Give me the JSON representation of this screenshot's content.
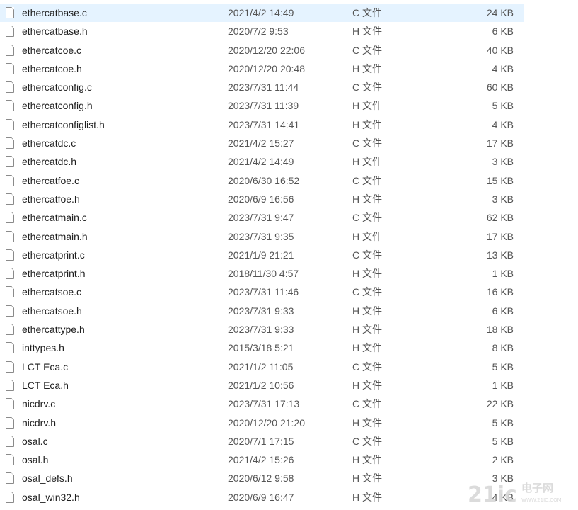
{
  "files": [
    {
      "name": "ethercatbase.c",
      "date": "2021/4/2 14:49",
      "type": "C 文件",
      "size": "24 KB",
      "selected": true
    },
    {
      "name": "ethercatbase.h",
      "date": "2020/7/2 9:53",
      "type": "H 文件",
      "size": "6 KB"
    },
    {
      "name": "ethercatcoe.c",
      "date": "2020/12/20 22:06",
      "type": "C 文件",
      "size": "40 KB"
    },
    {
      "name": "ethercatcoe.h",
      "date": "2020/12/20 20:48",
      "type": "H 文件",
      "size": "4 KB"
    },
    {
      "name": "ethercatconfig.c",
      "date": "2023/7/31 11:44",
      "type": "C 文件",
      "size": "60 KB"
    },
    {
      "name": "ethercatconfig.h",
      "date": "2023/7/31 11:39",
      "type": "H 文件",
      "size": "5 KB"
    },
    {
      "name": "ethercatconfiglist.h",
      "date": "2023/7/31 14:41",
      "type": "H 文件",
      "size": "4 KB"
    },
    {
      "name": "ethercatdc.c",
      "date": "2021/4/2 15:27",
      "type": "C 文件",
      "size": "17 KB"
    },
    {
      "name": "ethercatdc.h",
      "date": "2021/4/2 14:49",
      "type": "H 文件",
      "size": "3 KB"
    },
    {
      "name": "ethercatfoe.c",
      "date": "2020/6/30 16:52",
      "type": "C 文件",
      "size": "15 KB"
    },
    {
      "name": "ethercatfoe.h",
      "date": "2020/6/9 16:56",
      "type": "H 文件",
      "size": "3 KB"
    },
    {
      "name": "ethercatmain.c",
      "date": "2023/7/31 9:47",
      "type": "C 文件",
      "size": "62 KB"
    },
    {
      "name": "ethercatmain.h",
      "date": "2023/7/31 9:35",
      "type": "H 文件",
      "size": "17 KB"
    },
    {
      "name": "ethercatprint.c",
      "date": "2021/1/9 21:21",
      "type": "C 文件",
      "size": "13 KB"
    },
    {
      "name": "ethercatprint.h",
      "date": "2018/11/30 4:57",
      "type": "H 文件",
      "size": "1 KB"
    },
    {
      "name": "ethercatsoe.c",
      "date": "2023/7/31 11:46",
      "type": "C 文件",
      "size": "16 KB"
    },
    {
      "name": "ethercatsoe.h",
      "date": "2023/7/31 9:33",
      "type": "H 文件",
      "size": "6 KB"
    },
    {
      "name": "ethercattype.h",
      "date": "2023/7/31 9:33",
      "type": "H 文件",
      "size": "18 KB"
    },
    {
      "name": "inttypes.h",
      "date": "2015/3/18 5:21",
      "type": "H 文件",
      "size": "8 KB"
    },
    {
      "name": "LCT Eca.c",
      "date": "2021/1/2 11:05",
      "type": "C 文件",
      "size": "5 KB"
    },
    {
      "name": "LCT Eca.h",
      "date": "2021/1/2 10:56",
      "type": "H 文件",
      "size": "1 KB"
    },
    {
      "name": "nicdrv.c",
      "date": "2023/7/31 17:13",
      "type": "C 文件",
      "size": "22 KB"
    },
    {
      "name": "nicdrv.h",
      "date": "2020/12/20 21:20",
      "type": "H 文件",
      "size": "5 KB"
    },
    {
      "name": "osal.c",
      "date": "2020/7/1 17:15",
      "type": "C 文件",
      "size": "5 KB"
    },
    {
      "name": "osal.h",
      "date": "2021/4/2 15:26",
      "type": "H 文件",
      "size": "2 KB"
    },
    {
      "name": "osal_defs.h",
      "date": "2020/6/12 9:58",
      "type": "H 文件",
      "size": "3 KB"
    },
    {
      "name": "osal_win32.h",
      "date": "2020/6/9 16:47",
      "type": "H 文件",
      "size": "4 KB"
    }
  ],
  "watermark": {
    "digits": "21ic",
    "text": "电子网",
    "sub": "WWW.21IC.COM"
  }
}
